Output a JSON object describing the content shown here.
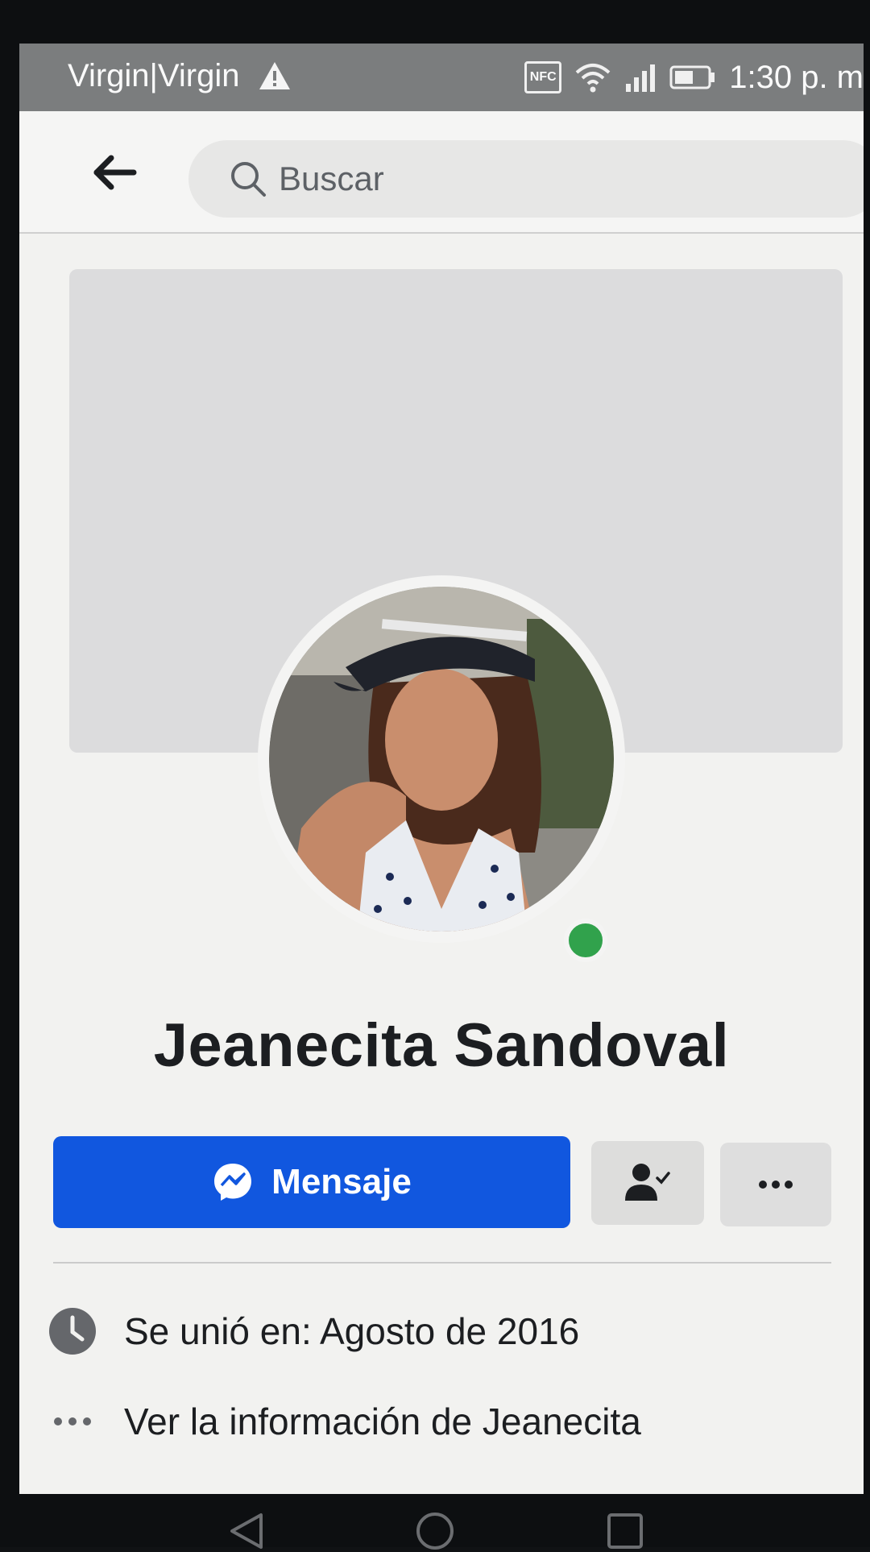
{
  "status_bar": {
    "carrier": "Virgin|Virgin",
    "nfc_label": "NFC",
    "time": "1:30 p. m",
    "icons": [
      "warning-icon",
      "nfc-icon",
      "wifi-icon",
      "signal-icon",
      "battery-icon"
    ]
  },
  "search": {
    "placeholder": "Buscar"
  },
  "profile": {
    "name": "Jeanecita Sandoval",
    "online": true
  },
  "actions": {
    "message_label": "Mensaje"
  },
  "info": {
    "joined": "Se unió en: Agosto de 2016",
    "about": "Ver la información de Jeanecita"
  },
  "colors": {
    "primary_button": "#1157df",
    "online_dot": "#31a24c",
    "text": "#1c1e21",
    "secondary_button": "#dddddc"
  }
}
